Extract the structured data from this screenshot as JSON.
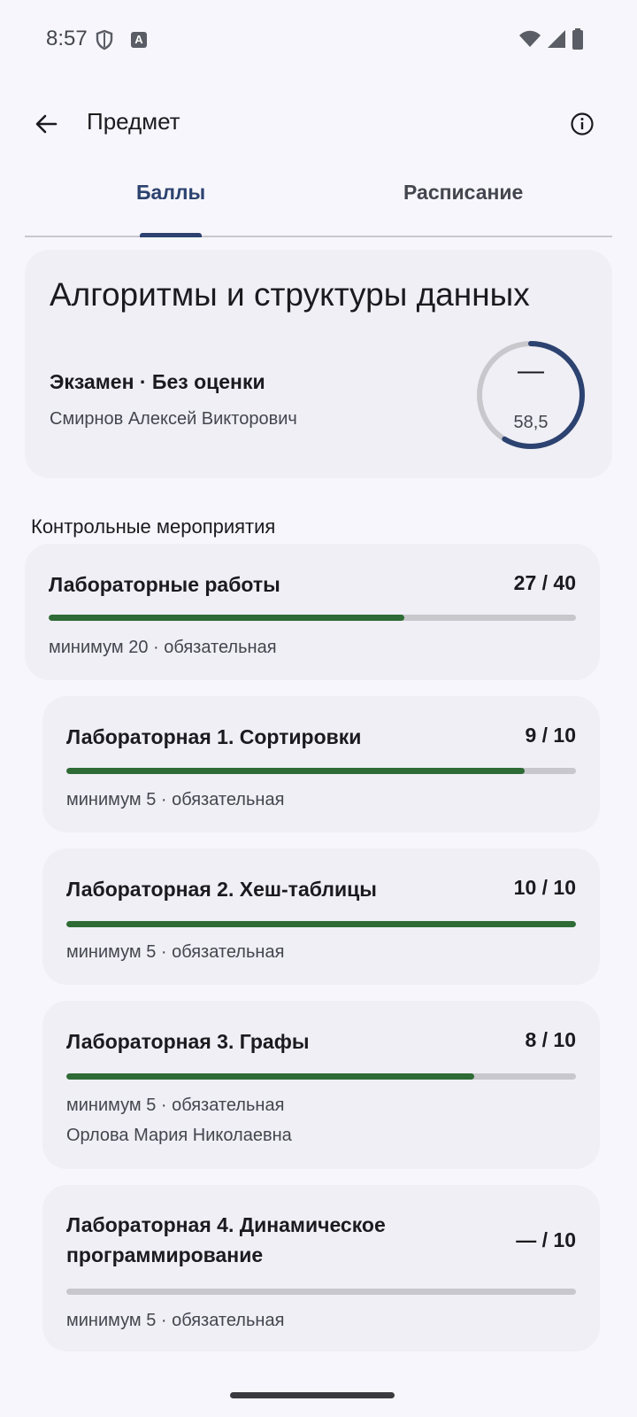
{
  "status": {
    "time": "8:57"
  },
  "app_bar": {
    "title": "Предмет"
  },
  "tabs": [
    {
      "label": "Баллы",
      "selected": true
    },
    {
      "label": "Расписание",
      "selected": false
    }
  ],
  "subject": {
    "name": "Алгоритмы и структуры данных",
    "exam_line": "Экзамен · Без оценки",
    "teacher": "Смирнов Алексей Викторович",
    "grade": "—",
    "score": "58,5",
    "score_fraction": 0.585
  },
  "section_title": "Контрольные мероприятия",
  "activities": [
    {
      "title": "Лабораторные работы",
      "score": "27 / 40",
      "progress": 0.675,
      "meta": "минимум 20 · обязательная"
    },
    {
      "title": "Лабораторная 1. Сортировки",
      "score": "9 / 10",
      "progress": 0.9,
      "meta": "минимум 5 · обязательная"
    },
    {
      "title": "Лабораторная 2. Хеш-таблицы",
      "score": "10 / 10",
      "progress": 1.0,
      "meta": "минимум 5 · обязательная"
    },
    {
      "title": "Лабораторная 3. Графы",
      "score": "8 / 10",
      "progress": 0.8,
      "meta": "минимум 5 · обязательная",
      "teacher": "Орлова Мария Николаевна"
    },
    {
      "title": "Лабораторная 4. Динамическое программирование",
      "score": "— / 10",
      "progress": 0,
      "meta": "минимум 5 · обязательная"
    }
  ],
  "colors": {
    "accent": "#2C4270",
    "progress": "#2E6B35",
    "track": "#C7C7CC",
    "card": "#EFEFF5",
    "background": "#F7F6FC"
  }
}
